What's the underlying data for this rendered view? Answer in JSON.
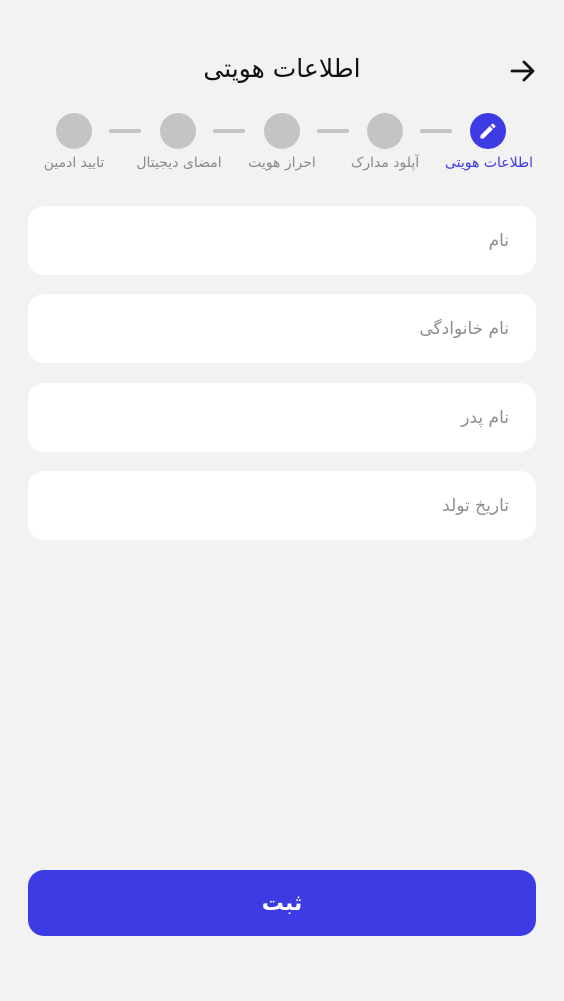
{
  "header": {
    "title": "اطلاعات هویتی",
    "back_icon": "arrow-right-icon"
  },
  "stepper": {
    "steps": [
      {
        "label": "اطلاعات هویتی",
        "state": "active",
        "icon": "pencil-icon"
      },
      {
        "label": "آپلود مدارک",
        "state": "pending"
      },
      {
        "label": "احراز هویت",
        "state": "pending"
      },
      {
        "label": "امضای دیجیتال",
        "state": "pending"
      },
      {
        "label": "تایید ادمین",
        "state": "pending"
      }
    ],
    "active_color": "#3d3be3",
    "inactive_color": "#c4c4c4"
  },
  "form": {
    "first_name": {
      "placeholder": "نام",
      "value": ""
    },
    "last_name": {
      "placeholder": "نام خانوادگی",
      "value": ""
    },
    "father_name": {
      "placeholder": "نام پدر",
      "value": ""
    },
    "birth_date": {
      "placeholder": "تاریخ تولد",
      "value": ""
    }
  },
  "submit": {
    "label": "ثبت",
    "color": "#3d3be3"
  }
}
